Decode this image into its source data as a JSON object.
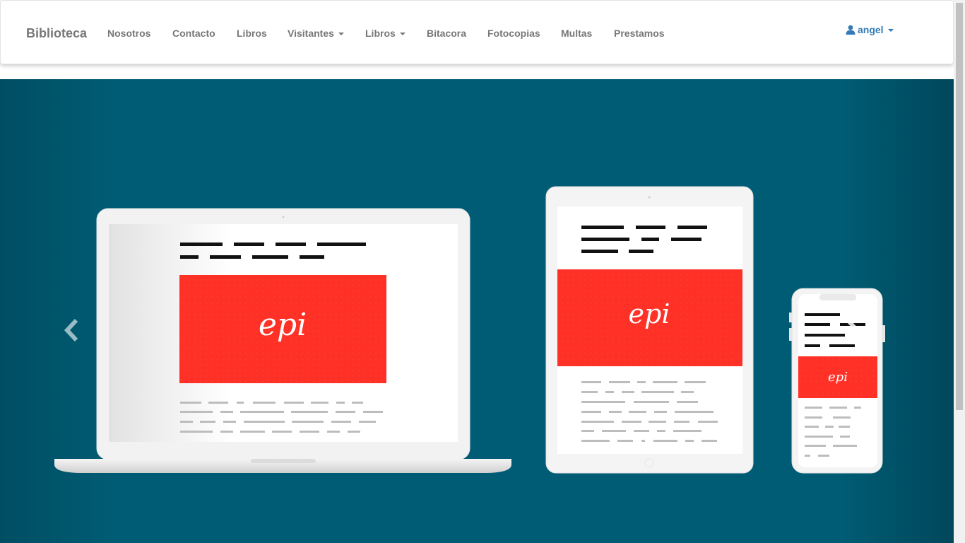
{
  "navbar": {
    "brand": "Biblioteca",
    "items": [
      {
        "label": "Nosotros"
      },
      {
        "label": "Contacto"
      },
      {
        "label": "Libros"
      },
      {
        "label": "Visitantes"
      },
      {
        "label": "Libros"
      },
      {
        "label": "Bitacora"
      },
      {
        "label": "Fotocopias"
      },
      {
        "label": "Multas"
      },
      {
        "label": "Prestamos"
      }
    ],
    "user": {
      "name": "angel",
      "icon": "user-icon"
    }
  },
  "carousel": {
    "slide_logo_text": "epi",
    "icons": {
      "prev": "chevron-left-icon",
      "next": "chevron-right-icon"
    }
  },
  "colors": {
    "background": "#005c74",
    "accent": "#ff3126",
    "brand_text": "#777777",
    "link": "#337ab7"
  }
}
